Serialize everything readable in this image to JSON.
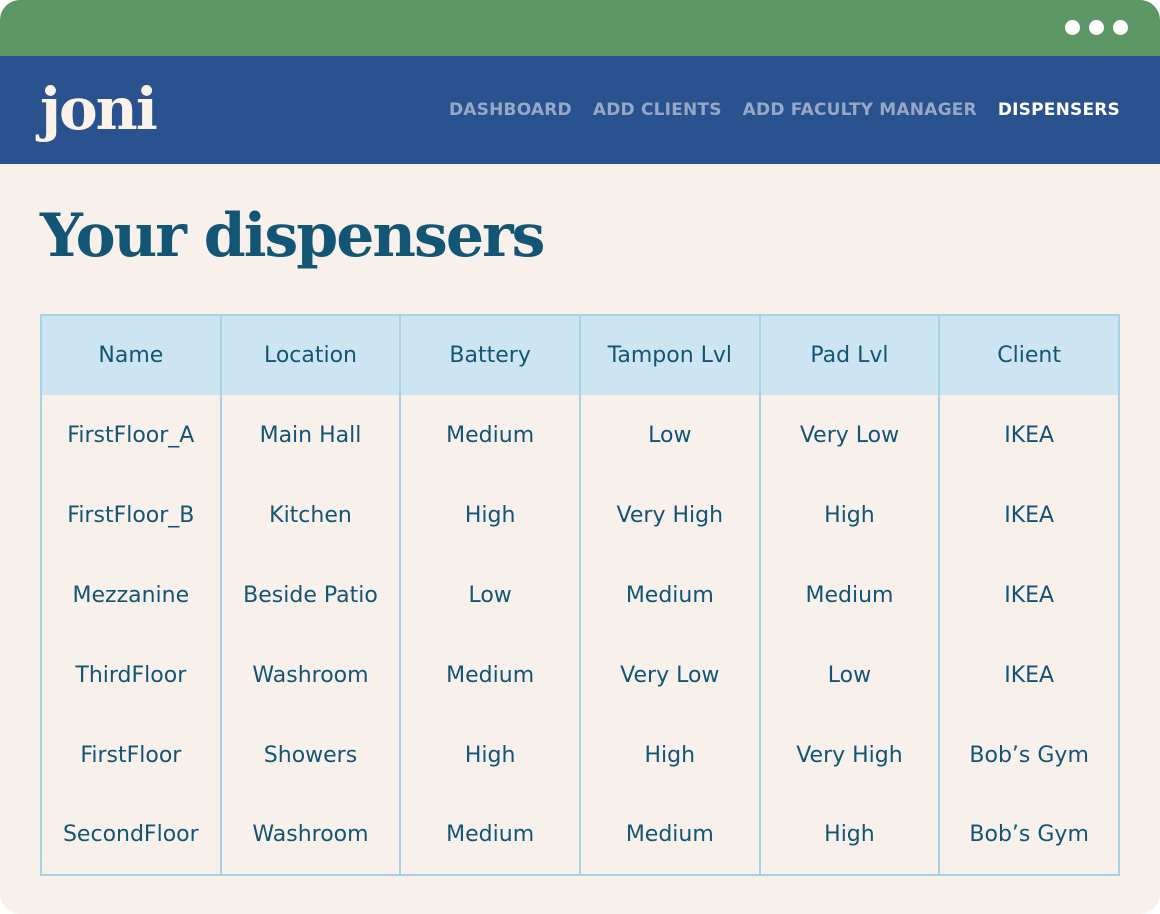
{
  "window": {
    "titlebar_color": "#5c9765",
    "controls": [
      "dot",
      "dot",
      "dot"
    ]
  },
  "header": {
    "logo": "joni",
    "nav": [
      {
        "label": "DASHBOARD",
        "active": false
      },
      {
        "label": "ADD CLIENTS",
        "active": false
      },
      {
        "label": "ADD FACULTY MANAGER",
        "active": false
      },
      {
        "label": "DISPENSERS",
        "active": true
      }
    ],
    "background_color": "#29528f"
  },
  "main": {
    "title": "Your dispensers",
    "table": {
      "columns": [
        "Name",
        "Location",
        "Battery",
        "Tampon Lvl",
        "Pad Lvl",
        "Client"
      ],
      "rows": [
        [
          "FirstFloor_A",
          "Main Hall",
          "Medium",
          "Low",
          "Very Low",
          "IKEA"
        ],
        [
          "FirstFloor_B",
          "Kitchen",
          "High",
          "Very High",
          "High",
          "IKEA"
        ],
        [
          "Mezzanine",
          "Beside Patio",
          "Low",
          "Medium",
          "Medium",
          "IKEA"
        ],
        [
          "ThirdFloor",
          "Washroom",
          "Medium",
          "Very Low",
          "Low",
          "IKEA"
        ],
        [
          "FirstFloor",
          "Showers",
          "High",
          "High",
          "Very High",
          "Bob’s Gym"
        ],
        [
          "SecondFloor",
          "Washroom",
          "Medium",
          "Medium",
          "High",
          "Bob’s Gym"
        ]
      ]
    }
  },
  "colors": {
    "page_background": "#f8f1eb",
    "text_primary": "#135575",
    "table_header_background": "#cde5f2",
    "table_border": "#a8d3e6",
    "nav_inactive": "#96a8c6",
    "nav_active": "#ffffff"
  }
}
